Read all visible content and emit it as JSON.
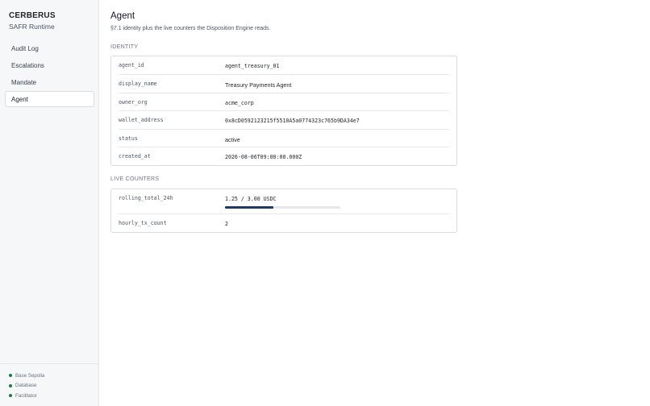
{
  "sidebar": {
    "brand_title": "CERBERUS",
    "brand_subtitle": "SAFR Runtime",
    "nav": [
      {
        "label": "Audit Log",
        "active": false
      },
      {
        "label": "Escalations",
        "active": false
      },
      {
        "label": "Mandate",
        "active": false
      },
      {
        "label": "Agent",
        "active": true
      }
    ],
    "status": [
      {
        "label": "Base Sepolia",
        "color": "#15803d"
      },
      {
        "label": "Database",
        "color": "#15803d"
      },
      {
        "label": "Facilitator",
        "color": "#15803d"
      }
    ]
  },
  "main": {
    "title": "Agent",
    "description": "§7.1 identity plus the live counters the Disposition Engine reads.",
    "identity": {
      "section_label": "IDENTITY",
      "rows": [
        {
          "key": "agent_id",
          "value": "agent_treasury_01",
          "mono": true
        },
        {
          "key": "display_name",
          "value": "Treasury Payments Agent",
          "mono": false
        },
        {
          "key": "owner_org",
          "value": "acme_corp",
          "mono": true
        },
        {
          "key": "wallet_address",
          "value": "0x8cD0592123215f5510A5a0774323c765b9DA34e7",
          "mono": true
        },
        {
          "key": "status",
          "value": "active",
          "mono": false
        },
        {
          "key": "created_at",
          "value": "2026-08-06T09:00:00.000Z",
          "mono": true
        }
      ]
    },
    "live_counters": {
      "section_label": "LIVE COUNTERS",
      "rolling_total": {
        "key": "rolling_total_24h",
        "value": "1.25 / 3.00 USDC",
        "fraction": 0.4167
      },
      "hourly": {
        "key": "hourly_tx_count",
        "value": "2"
      }
    }
  }
}
